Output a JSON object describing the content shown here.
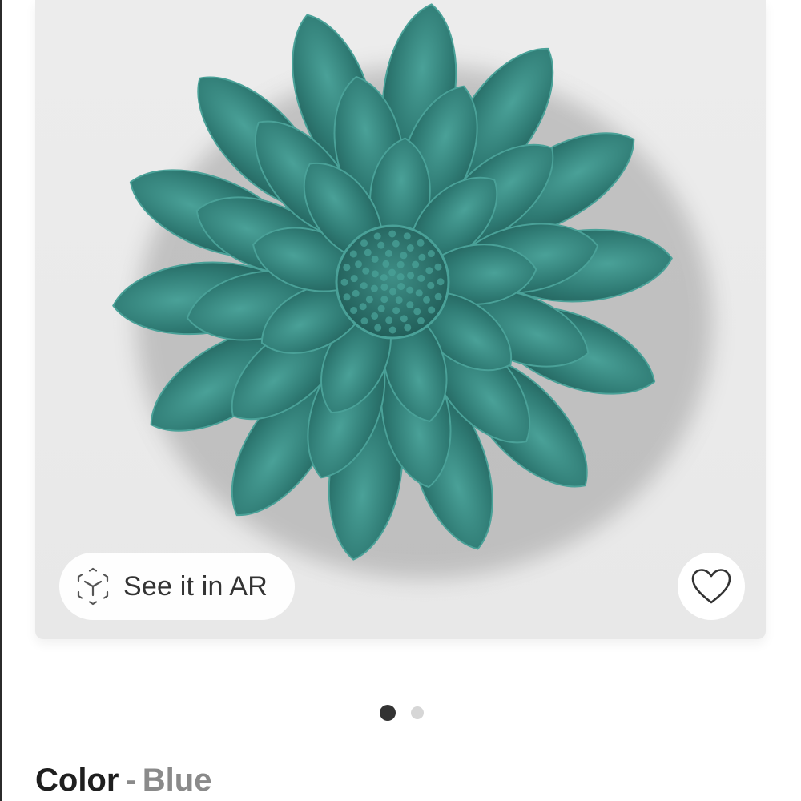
{
  "product": {
    "image_alt": "Teal ceramic flower wall decor",
    "ar_button_label": "See it in AR",
    "favorite_icon": "heart-outline-icon",
    "ar_icon": "cube-ar-icon"
  },
  "pager": {
    "total": 2,
    "active_index": 0
  },
  "color": {
    "title": "Color",
    "separator": "-",
    "value": "Blue"
  },
  "colors": {
    "petal": "#2f7b74",
    "petal_dark": "#1f5a55",
    "petal_light": "#4aa198",
    "background": "#ececec",
    "dot_active": "#333333",
    "dot_inactive": "#d6d6d6"
  }
}
